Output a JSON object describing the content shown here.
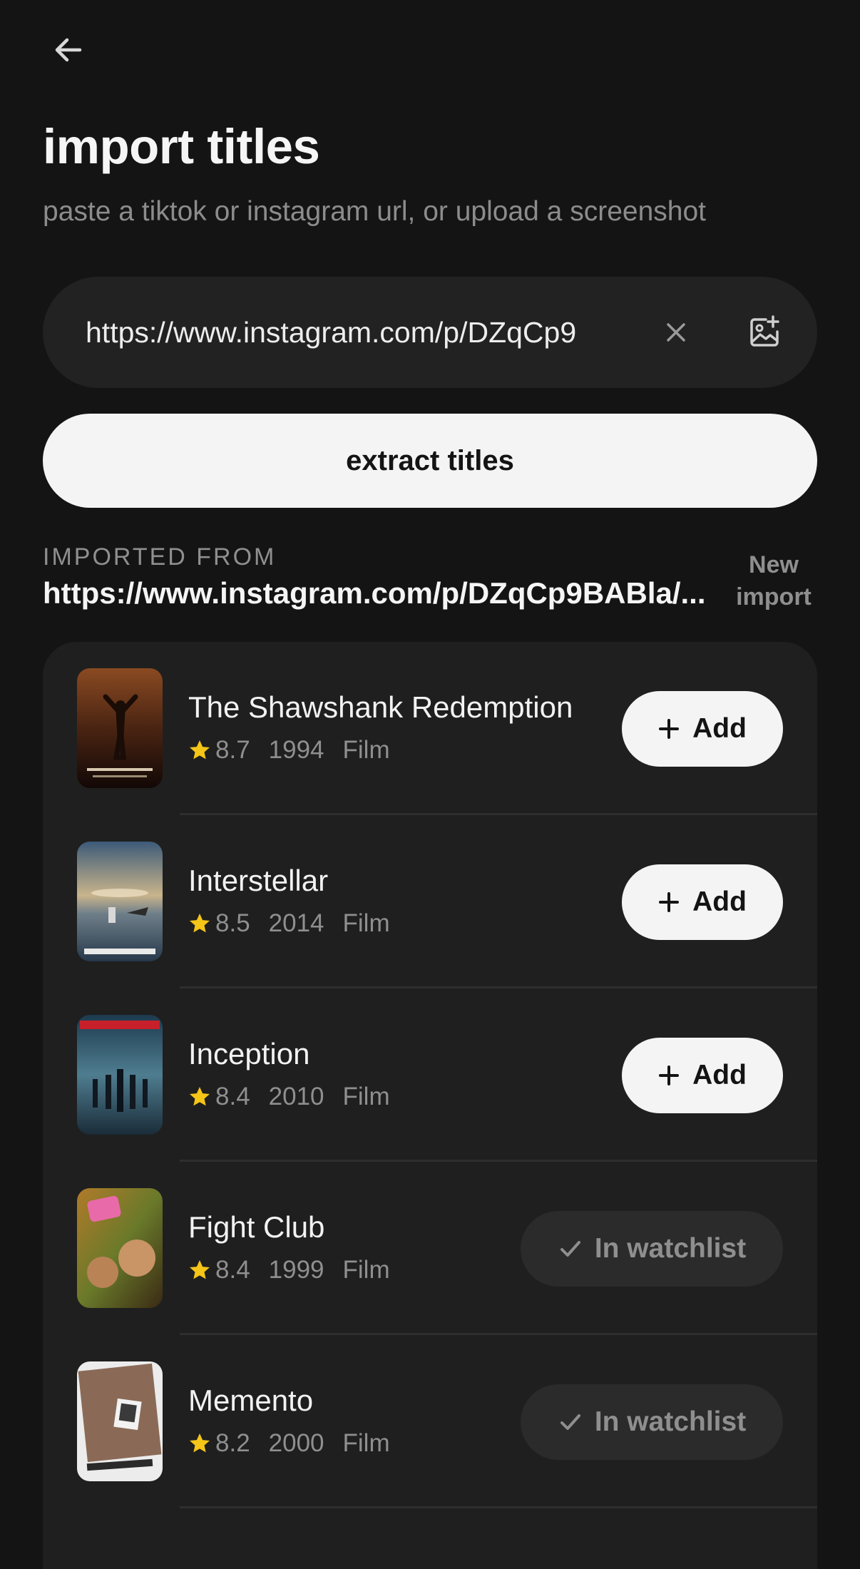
{
  "header": {
    "back_icon": "arrow-left-icon",
    "title": "import titles",
    "subtitle": "paste a tiktok or instagram url, or upload a screenshot"
  },
  "url_input": {
    "value": "https://www.instagram.com/p/DZqCp9",
    "clear_icon": "close-icon",
    "upload_icon": "image-add-icon"
  },
  "extract_button": {
    "label": "extract titles"
  },
  "imported": {
    "label": "IMPORTED FROM",
    "url": "https://www.instagram.com/p/DZqCp9BABla/...",
    "new_import_label": "New import"
  },
  "titles": [
    {
      "title": "The Shawshank Redemption",
      "rating": "8.7",
      "year": "1994",
      "kind": "Film",
      "status": "add",
      "button_label": "Add"
    },
    {
      "title": "Interstellar",
      "rating": "8.5",
      "year": "2014",
      "kind": "Film",
      "status": "add",
      "button_label": "Add"
    },
    {
      "title": "Inception",
      "rating": "8.4",
      "year": "2010",
      "kind": "Film",
      "status": "add",
      "button_label": "Add"
    },
    {
      "title": "Fight Club",
      "rating": "8.4",
      "year": "1999",
      "kind": "Film",
      "status": "in_watchlist",
      "button_label": "In watchlist"
    },
    {
      "title": "Memento",
      "rating": "8.2",
      "year": "2000",
      "kind": "Film",
      "status": "in_watchlist",
      "button_label": "In watchlist"
    }
  ],
  "colors": {
    "background": "#141414",
    "card": "#1f1f1f",
    "star": "#f5c518",
    "muted_text": "#8f8f8f",
    "primary_button": "#f4f4f4"
  }
}
